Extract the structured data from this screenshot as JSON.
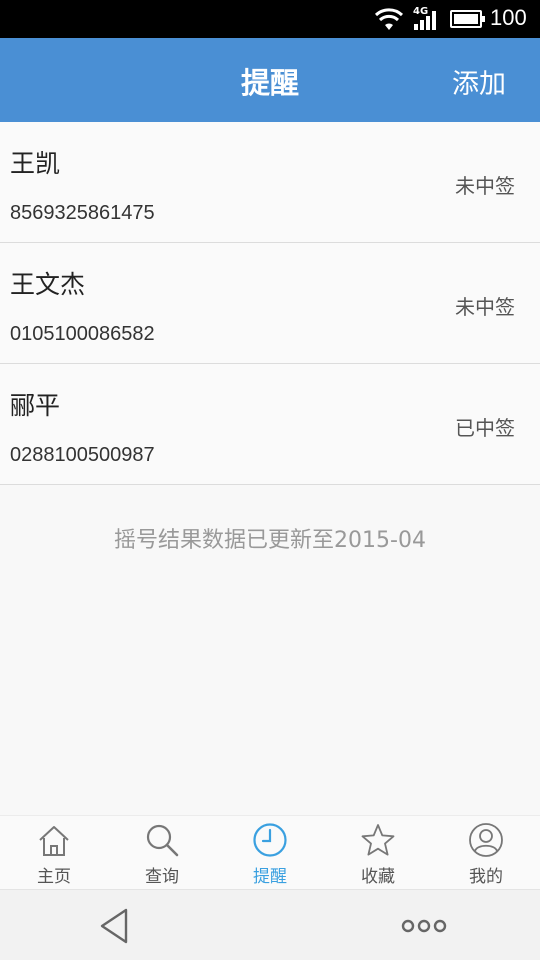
{
  "status_bar": {
    "network_label": "4G",
    "battery_text": "100",
    "icons": [
      "wifi-icon",
      "signal-icon",
      "battery-icon"
    ]
  },
  "header": {
    "title": "提醒",
    "add_label": "添加"
  },
  "list": [
    {
      "name": "王凯",
      "number": "8569325861475",
      "status": "未中签"
    },
    {
      "name": "王文杰",
      "number": "0105100086582",
      "status": "未中签"
    },
    {
      "name": "郦平",
      "number": "0288100500987",
      "status": "已中签"
    }
  ],
  "update_note": "摇号结果数据已更新至2015-04",
  "tabs": [
    {
      "label": "主页",
      "icon": "home-icon",
      "active": false
    },
    {
      "label": "查询",
      "icon": "search-icon",
      "active": false
    },
    {
      "label": "提醒",
      "icon": "clock-icon",
      "active": true
    },
    {
      "label": "收藏",
      "icon": "star-icon",
      "active": false
    },
    {
      "label": "我的",
      "icon": "user-icon",
      "active": false
    }
  ],
  "colors": {
    "header_bg": "#4a8fd4",
    "active_tab": "#3aa0e0",
    "inactive_tab": "#555555"
  }
}
